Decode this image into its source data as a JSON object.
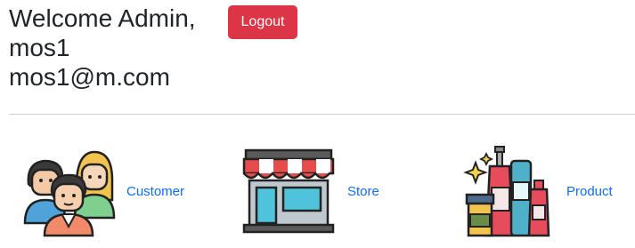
{
  "header": {
    "welcome_line": "Welcome Admin,",
    "username": "mos1",
    "email": "mos1@m.com",
    "logout_label": "Logout"
  },
  "menu": {
    "items": [
      {
        "label": "Customer",
        "icon": "customers-icon"
      },
      {
        "label": "Store",
        "icon": "store-icon"
      },
      {
        "label": "Product",
        "icon": "products-icon"
      }
    ]
  },
  "colors": {
    "logout": "#dc3545",
    "link": "#0d6efd",
    "text": "#212529"
  }
}
